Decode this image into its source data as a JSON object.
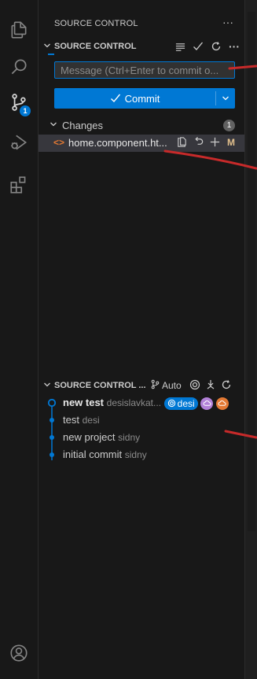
{
  "colors": {
    "accent": "#0078d4",
    "modified": "#e2c08d",
    "graph_blue": "#0078d4",
    "ref_purple": "#b180d7",
    "ref_orange": "#e37933",
    "annotation_red": "#c72a2a"
  },
  "activity_bar": {
    "items": [
      {
        "icon": "files-icon"
      },
      {
        "icon": "search-icon"
      },
      {
        "icon": "source-control-icon",
        "badge": "1"
      },
      {
        "icon": "run-debug-icon"
      },
      {
        "icon": "extensions-icon"
      }
    ],
    "bottom": {
      "icon": "account-icon"
    }
  },
  "view": {
    "title": "SOURCE CONTROL",
    "more": "···"
  },
  "scm": {
    "header": "SOURCE CONTROL",
    "message_placeholder": "Message (Ctrl+Enter to commit o...",
    "commit_label": "Commit",
    "changes_label": "Changes",
    "changes_count": "1",
    "file": {
      "name": "home.component.ht...",
      "status": "M"
    }
  },
  "graph": {
    "header": "SOURCE CONTROL ...",
    "auto_label": "Auto",
    "commits": [
      {
        "message": "new test",
        "author": "desislavkat...",
        "ref_label": "desi"
      },
      {
        "message": "test",
        "author": "desi"
      },
      {
        "message": "new project",
        "author": "sidny"
      },
      {
        "message": "initial commit",
        "author": "sidny"
      }
    ]
  }
}
